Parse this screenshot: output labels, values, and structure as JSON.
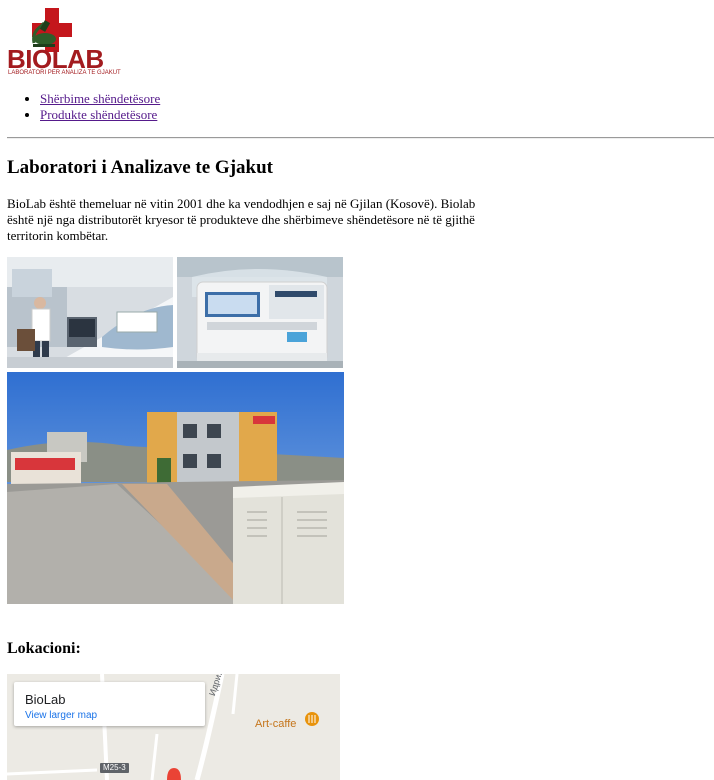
{
  "logo": {
    "brand": "BIOLAB",
    "tagline": "LABORATORI PER ANALIZA TE GJAKUT",
    "cross_color": "#c4161c",
    "text_color": "#a31b1f"
  },
  "nav": {
    "items": [
      {
        "label": "Shërbime shëndetësore"
      },
      {
        "label": "Produkte shëndetësore"
      }
    ],
    "link_color": "#551a8b"
  },
  "main": {
    "title": "Laboratori i Analizave te Gjakut",
    "intro": "BioLab është themeluar në vitin 2001 dhe ka vendodhjen e saj në Gjilan (Kosovë). Biolab është një nga distributorët kryesor të produkteve dhe shërbimeve shëndetësore në të gjithë territorin kombëtar.",
    "photos": [
      {
        "icon": "lab-technician-photo"
      },
      {
        "icon": "analyzer-machine-photo"
      },
      {
        "icon": "building-exterior-photo"
      }
    ],
    "location_heading": "Lokacioni:"
  },
  "map": {
    "place_name": "BioLab",
    "view_larger": "View larger map",
    "poi_label": "Art-caffe",
    "road_label": "Идриза С",
    "route_badge": "M25-3",
    "poi_color": "#c5751a",
    "link_color": "#1a73e8"
  }
}
